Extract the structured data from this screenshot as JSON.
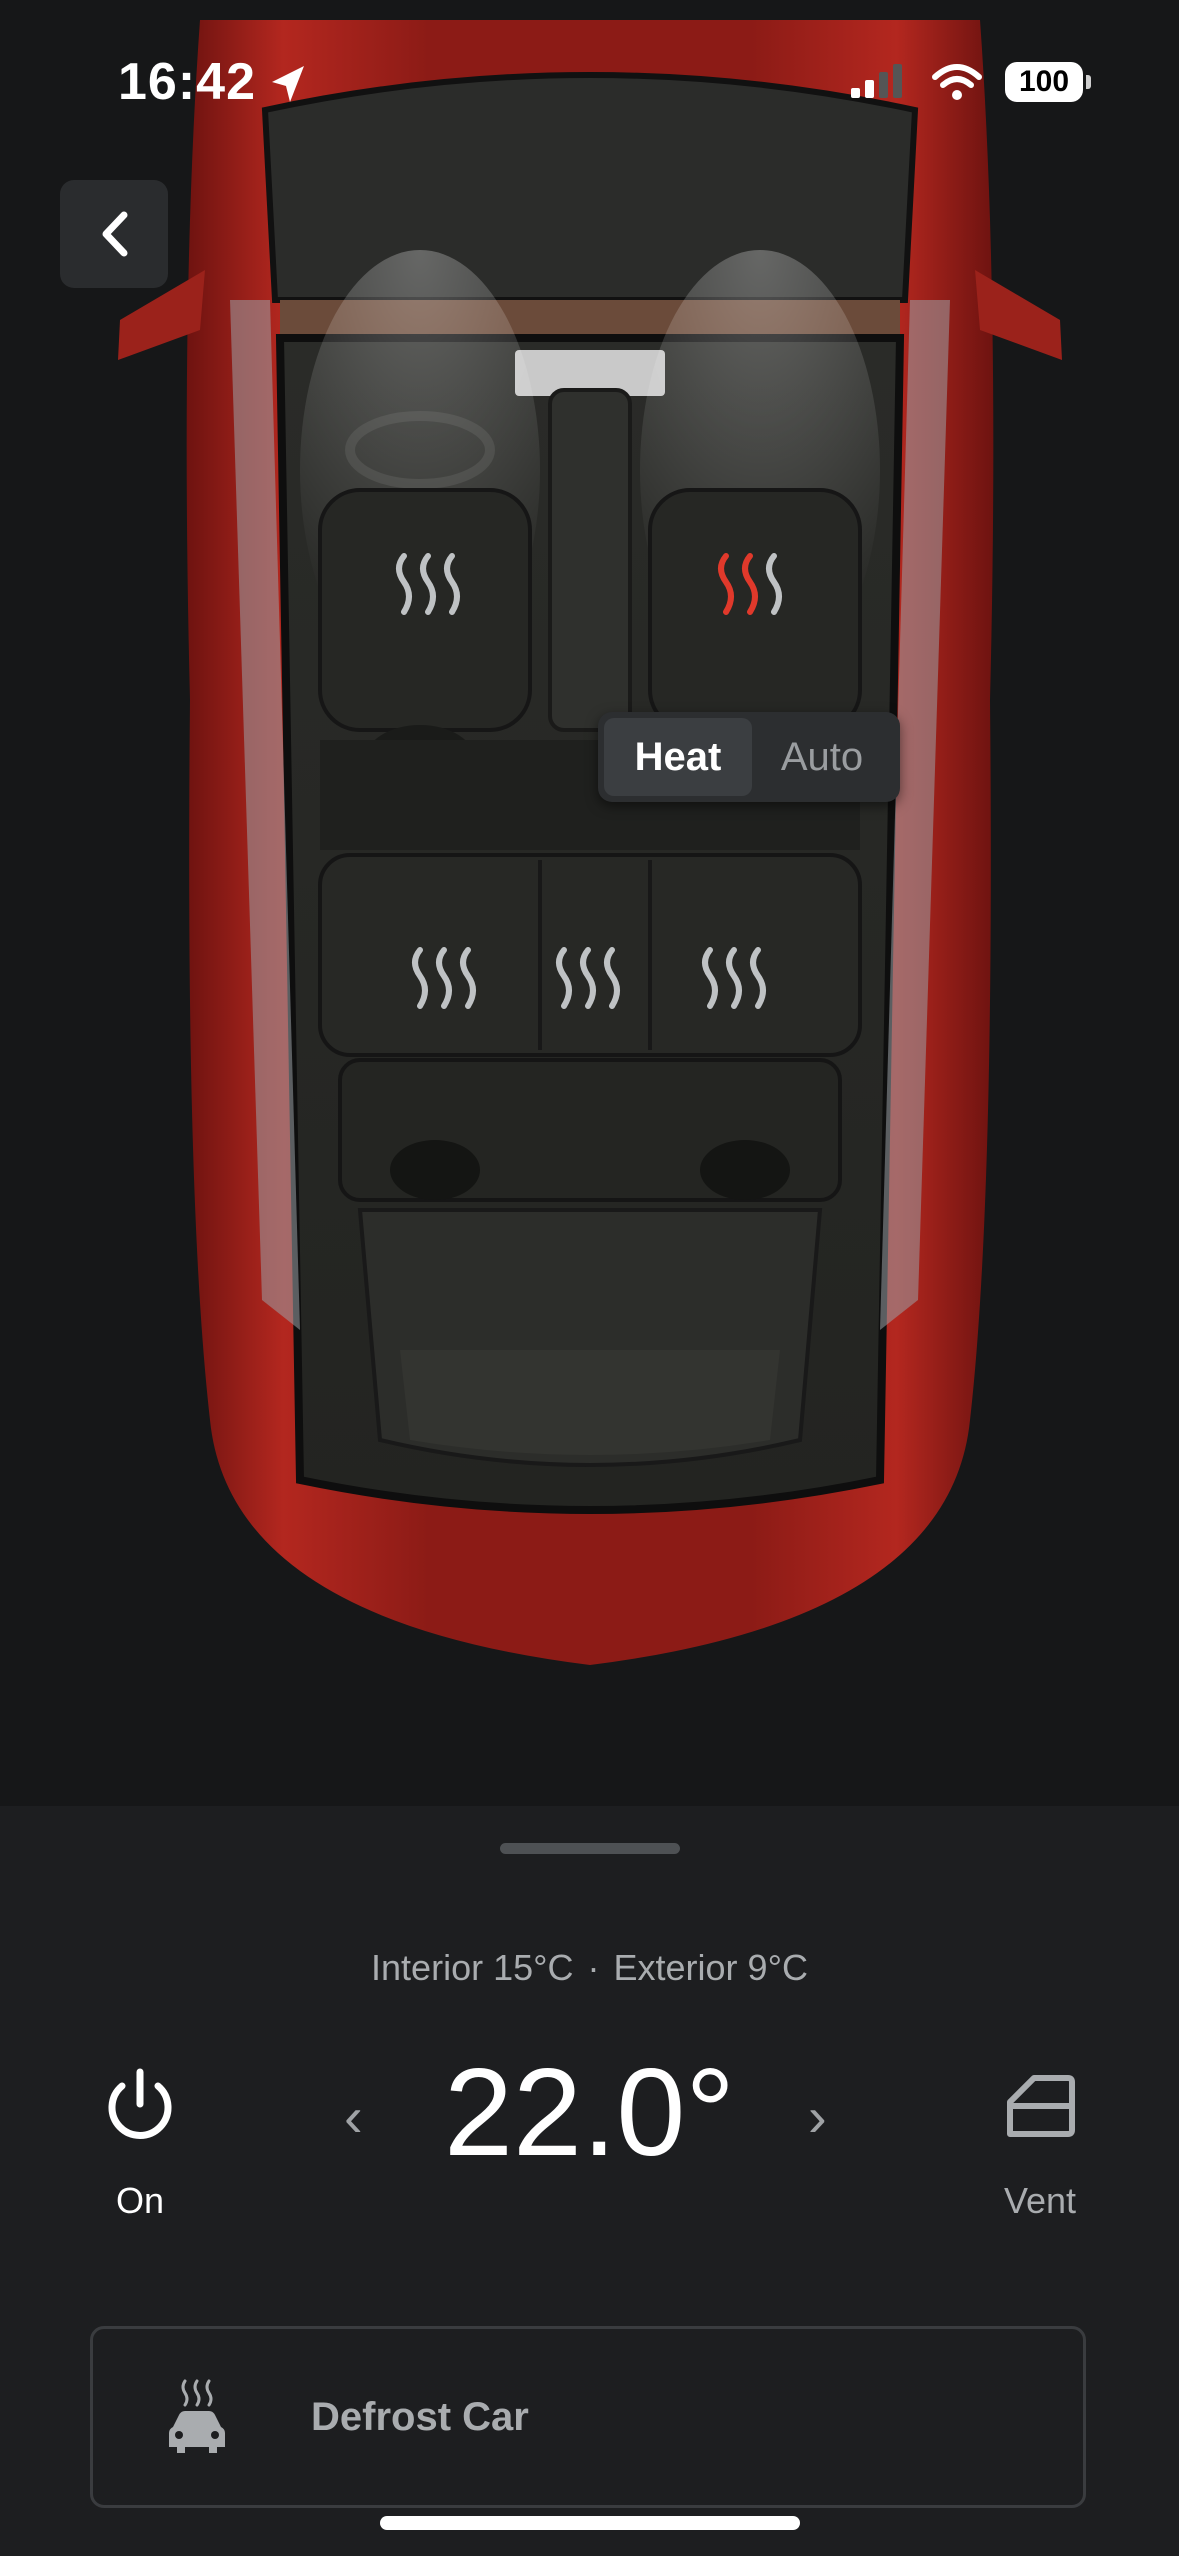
{
  "status_bar": {
    "time": "16:42",
    "battery": "100",
    "icons": [
      "location-arrow-icon",
      "signal-icon",
      "wifi-icon",
      "battery-icon"
    ]
  },
  "seat_heaters": {
    "front_left": {
      "icon": "seat-heat-icon",
      "active": false
    },
    "front_right": {
      "icon": "seat-heat-icon",
      "active": true,
      "color": "#e0392b"
    },
    "rear_left": {
      "icon": "seat-heat-icon",
      "active": false
    },
    "rear_center": {
      "icon": "seat-heat-icon",
      "active": false
    },
    "rear_right": {
      "icon": "seat-heat-icon",
      "active": false
    }
  },
  "mode_toggle": {
    "options": [
      "Heat",
      "Auto"
    ],
    "selected": "Heat"
  },
  "climate": {
    "temps_line": {
      "interior": "Interior 15°C",
      "separator": "·",
      "exterior": "Exterior 9°C"
    },
    "power_label": "On",
    "setpoint": "22.0°",
    "decrease_glyph": "‹",
    "increase_glyph": "›",
    "vent_label": "Vent",
    "defrost_label": "Defrost Car"
  },
  "colors": {
    "background": "#161718",
    "panel": "#1d1e20",
    "car_body": "#a8221c",
    "heat_active": "#e0392b"
  }
}
